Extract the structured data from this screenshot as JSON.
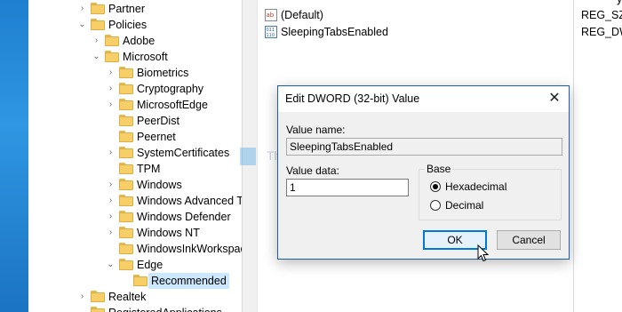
{
  "tree": {
    "items": [
      {
        "label": "Partner",
        "expander": "›"
      },
      {
        "label": "Policies",
        "expander": "⌄"
      },
      {
        "label": "Adobe",
        "expander": "›"
      },
      {
        "label": "Microsoft",
        "expander": "⌄"
      },
      {
        "label": "Biometrics",
        "expander": "›"
      },
      {
        "label": "Cryptography",
        "expander": "›"
      },
      {
        "label": "MicrosoftEdge",
        "expander": "›"
      },
      {
        "label": "PeerDist",
        "expander": ""
      },
      {
        "label": "Peernet",
        "expander": ""
      },
      {
        "label": "SystemCertificates",
        "expander": "›"
      },
      {
        "label": "TPM",
        "expander": ""
      },
      {
        "label": "Windows",
        "expander": "›"
      },
      {
        "label": "Windows Advanced T",
        "expander": "›"
      },
      {
        "label": "Windows Defender",
        "expander": "›"
      },
      {
        "label": "Windows NT",
        "expander": "›"
      },
      {
        "label": "WindowsInkWorkspac",
        "expander": ""
      },
      {
        "label": "Edge",
        "expander": "⌄"
      },
      {
        "label": "Recommended",
        "expander": ""
      },
      {
        "label": "Realtek",
        "expander": "›"
      },
      {
        "label": "RegisteredApplications",
        "expander": ""
      }
    ]
  },
  "values_pane": {
    "header_type_partial": "y",
    "rows": [
      {
        "name": "(Default)",
        "type": "REG_SZ",
        "icon": "string-value-icon"
      },
      {
        "name": "SleepingTabsEnabled",
        "type": "REG_DW",
        "icon": "dword-value-icon"
      }
    ]
  },
  "watermark": {
    "text": "TheWindowsClub"
  },
  "dialog": {
    "title": "Edit DWORD (32-bit) Value",
    "value_name_label": "Value name:",
    "value_name": "SleepingTabsEnabled",
    "value_data_label": "Value data:",
    "value_data": "1",
    "base_label": "Base",
    "hex_label": "Hexadecimal",
    "dec_label": "Decimal",
    "selected_base": "Hexadecimal",
    "ok_label": "OK",
    "cancel_label": "Cancel"
  },
  "colors": {
    "selection": "#cce8ff",
    "folder": "#f6cf68",
    "dialog_border": "#1d5fa8",
    "default_button_border": "#0078d7",
    "desktop": "#2f97e3"
  }
}
